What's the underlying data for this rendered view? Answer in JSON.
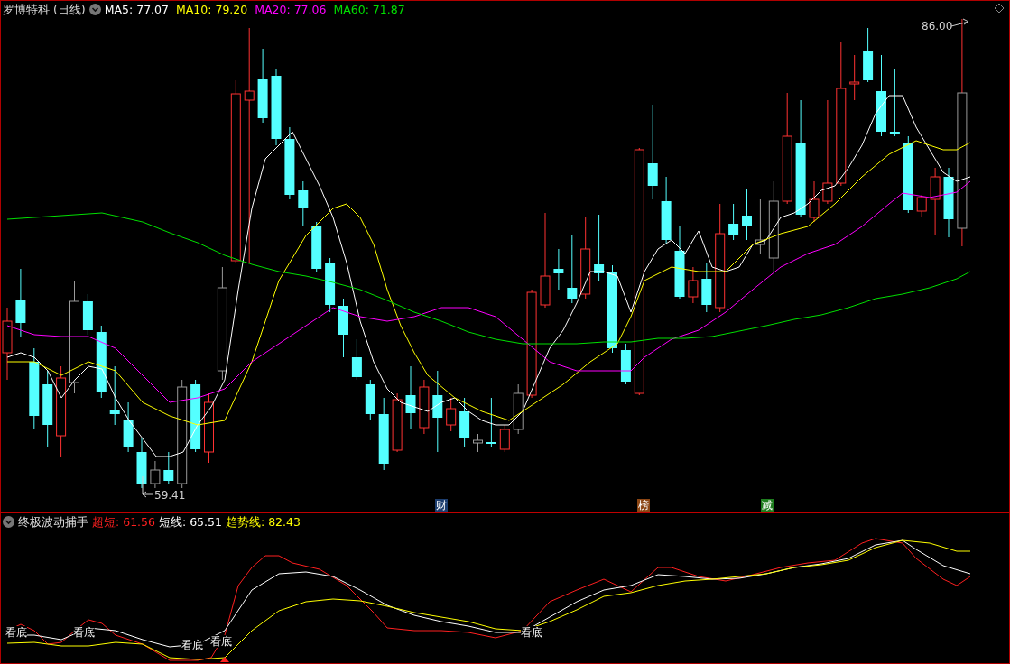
{
  "main_chart": {
    "title": "罗博特科 (日线)",
    "indicators": [
      {
        "label": "MA5: 77.07",
        "color": "#ffffff"
      },
      {
        "label": "MA10: 79.20",
        "color": "#ffff00"
      },
      {
        "label": "MA20: 77.06",
        "color": "#ff00ff"
      },
      {
        "label": "MA60: 71.87",
        "color": "#00e000"
      }
    ],
    "high_label": "86.00",
    "low_label": "59.41",
    "markers": [
      {
        "text": "财",
        "color": "#1c3d6e"
      },
      {
        "text": "榜",
        "color": "#8b4513"
      },
      {
        "text": "减",
        "color": "#1e7d1e"
      }
    ]
  },
  "sub_chart": {
    "title": "终极波动捕手",
    "indicators": [
      {
        "name": "超短:",
        "value": "61.56",
        "color": "#ff2020"
      },
      {
        "name": "短线:",
        "value": "65.51",
        "color": "#ffffff"
      },
      {
        "name": "趋势线:",
        "value": "82.43",
        "color": "#ffff00"
      }
    ],
    "signals": [
      {
        "text": "看底"
      },
      {
        "text": "看底"
      },
      {
        "text": "看底"
      },
      {
        "text": "看底"
      },
      {
        "text": "看底"
      }
    ]
  }
}
